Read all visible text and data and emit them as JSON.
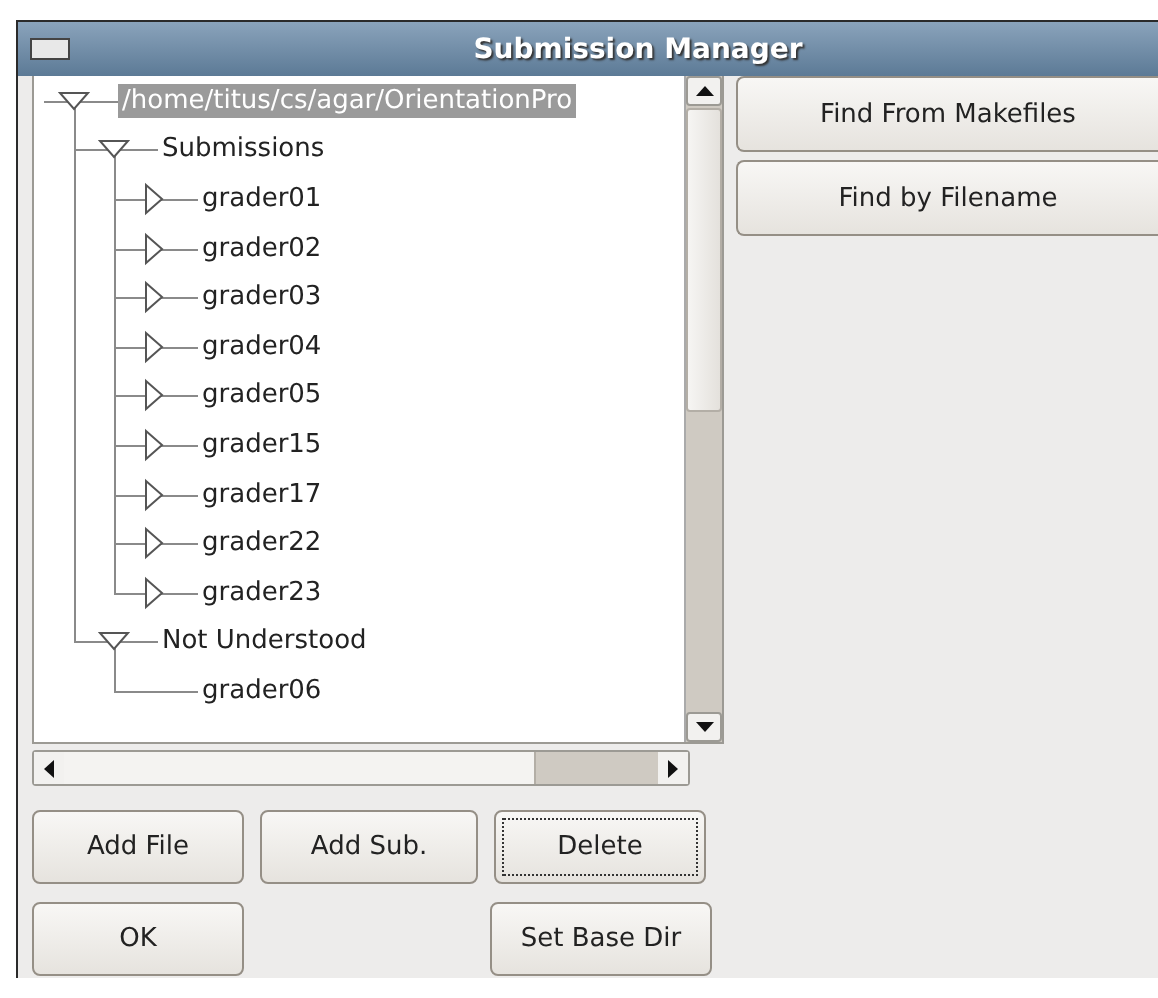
{
  "window": {
    "title": "Submission Manager"
  },
  "tree": [
    {
      "label": "/home/titus/cs/agar/OrientationPro",
      "selected": true,
      "expanded": true,
      "children": [
        {
          "label": "Submissions",
          "selected": false,
          "expanded": true,
          "children": [
            {
              "label": "grader01",
              "selected": false,
              "expanded": false
            },
            {
              "label": "grader02",
              "selected": false,
              "expanded": false
            },
            {
              "label": "grader03",
              "selected": false,
              "expanded": false
            },
            {
              "label": "grader04",
              "selected": false,
              "expanded": false
            },
            {
              "label": "grader05",
              "selected": false,
              "expanded": false
            },
            {
              "label": "grader15",
              "selected": false,
              "expanded": false
            },
            {
              "label": "grader17",
              "selected": false,
              "expanded": false
            },
            {
              "label": "grader22",
              "selected": false,
              "expanded": false
            },
            {
              "label": "grader23",
              "selected": false,
              "expanded": false
            }
          ]
        },
        {
          "label": "Not Understood",
          "selected": false,
          "expanded": true,
          "children": [
            {
              "label": "grader06",
              "selected": false
            }
          ]
        }
      ]
    }
  ],
  "side_buttons": [
    "Find From Makefiles",
    "Find by Filename"
  ],
  "bottom_buttons": [
    {
      "label": "Add File",
      "focused": false
    },
    {
      "label": "Add Sub.",
      "focused": false
    },
    {
      "label": "Delete",
      "focused": true
    }
  ],
  "footer_buttons": [
    "OK",
    "Set Base Dir"
  ]
}
